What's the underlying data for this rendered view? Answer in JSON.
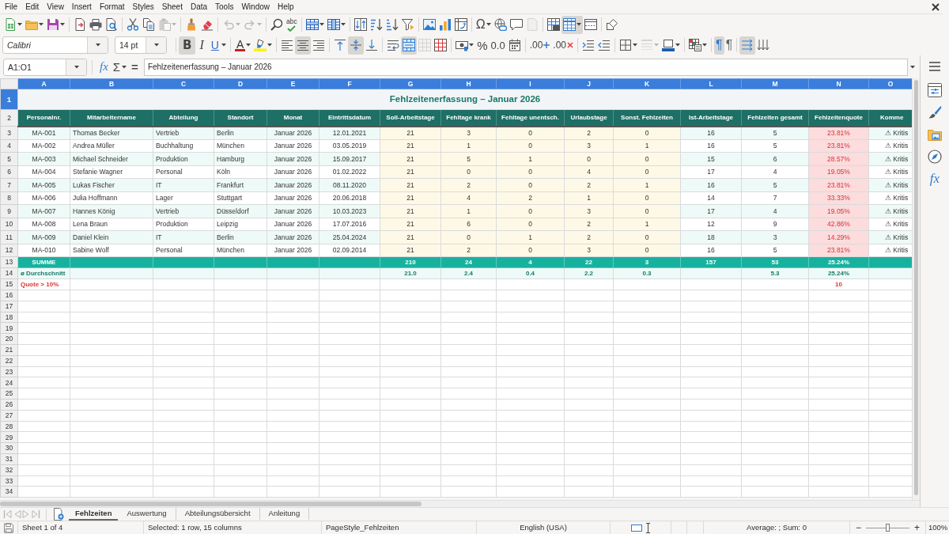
{
  "menu_bar": [
    "File",
    "Edit",
    "View",
    "Insert",
    "Format",
    "Styles",
    "Sheet",
    "Data",
    "Tools",
    "Window",
    "Help"
  ],
  "standard_toolbar": {
    "buttons": [
      {
        "on": false,
        "disabled": false
      },
      {
        "on": false,
        "disabled": false
      },
      {
        "on": false,
        "disabled": false
      },
      {
        "on": false,
        "disabled": false
      },
      {
        "on": false,
        "disabled": false
      },
      {
        "on": false,
        "disabled": false
      },
      {
        "on": false,
        "disabled": false
      },
      {
        "on": false,
        "disabled": false
      },
      {
        "on": false,
        "disabled": true
      },
      {
        "on": false,
        "disabled": false
      },
      {
        "on": false,
        "disabled": false
      },
      {
        "on": false,
        "disabled": true
      },
      {
        "on": false,
        "disabled": true
      },
      {
        "on": false,
        "disabled": false
      },
      {
        "glyph": "abc",
        "on": false,
        "disabled": false
      },
      {
        "on": false,
        "disabled": false
      },
      {
        "on": false,
        "disabled": false
      },
      {
        "on": false,
        "disabled": false
      },
      {
        "on": false,
        "disabled": false
      },
      {
        "on": false,
        "disabled": false
      },
      {
        "on": false,
        "disabled": false
      },
      {
        "on": false,
        "disabled": false
      },
      {
        "on": false,
        "disabled": false
      },
      {
        "on": false,
        "disabled": false
      },
      {
        "glyph": "Ω",
        "on": false,
        "disabled": false
      },
      {
        "on": false,
        "disabled": false
      },
      {
        "on": false,
        "disabled": false
      },
      {
        "on": false,
        "disabled": true
      },
      {
        "on": false,
        "disabled": false
      },
      {
        "on": true,
        "disabled": false
      },
      {
        "on": false,
        "disabled": false
      },
      {
        "on": false,
        "disabled": false
      }
    ]
  },
  "formatting_toolbar": {
    "font_name": "Calibri",
    "font_size": "14 pt",
    "buttons": [
      {
        "glyph": "B",
        "on": true,
        "disabled": false
      },
      {
        "glyph": "I",
        "on": false,
        "disabled": false
      },
      {
        "glyph": "U",
        "on": false,
        "disabled": false
      },
      {
        "glyph": "A",
        "on": false,
        "disabled": false
      },
      {
        "on": false,
        "disabled": false
      },
      {
        "on": false,
        "disabled": false
      },
      {
        "on": true,
        "disabled": false
      },
      {
        "on": false,
        "disabled": false
      },
      {
        "on": false,
        "disabled": false
      },
      {
        "on": true,
        "disabled": false
      },
      {
        "on": false,
        "disabled": false
      },
      {
        "on": false,
        "disabled": false
      },
      {
        "on": true,
        "disabled": false
      },
      {
        "on": false,
        "disabled": true
      },
      {
        "on": false,
        "disabled": false
      },
      {
        "on": false,
        "disabled": false
      },
      {
        "glyph": "%",
        "on": false,
        "disabled": false
      },
      {
        "glyph": "0.0",
        "on": false,
        "disabled": false
      },
      {
        "on": false,
        "disabled": false
      },
      {
        "glyph": ".00",
        "on": false,
        "disabled": false
      },
      {
        "glyph": ".00",
        "on": false,
        "disabled": false
      },
      {
        "on": false,
        "disabled": false
      },
      {
        "on": false,
        "disabled": false
      },
      {
        "on": false,
        "disabled": false
      },
      {
        "on": false,
        "disabled": true
      },
      {
        "on": false,
        "disabled": false
      },
      {
        "on": false,
        "disabled": false
      },
      {
        "glyph": "¶",
        "on": true,
        "disabled": false
      },
      {
        "glyph": "¶",
        "on": false,
        "disabled": false
      },
      {
        "on": true,
        "disabled": false
      },
      {
        "on": false,
        "disabled": false
      }
    ]
  },
  "formula_bar": {
    "name_box": "A1:O1",
    "function_wizard": "fx",
    "sum": "Σ",
    "equals": "=",
    "formula": "Fehlzeitenerfassung – Januar 2026"
  },
  "spreadsheet": {
    "columns": [
      {
        "label": "A",
        "selected": true
      },
      {
        "label": "B",
        "selected": true
      },
      {
        "label": "C",
        "selected": true
      },
      {
        "label": "D",
        "selected": true
      },
      {
        "label": "E",
        "selected": true
      },
      {
        "label": "F",
        "selected": true
      },
      {
        "label": "G",
        "selected": true
      },
      {
        "label": "H",
        "selected": true
      },
      {
        "label": "I",
        "selected": true
      },
      {
        "label": "J",
        "selected": true
      },
      {
        "label": "K",
        "selected": true
      },
      {
        "label": "L",
        "selected": true
      },
      {
        "label": "M",
        "selected": true
      },
      {
        "label": "N",
        "selected": true
      },
      {
        "label": "O",
        "selected": true
      }
    ],
    "row_headers": [
      {
        "label": "1",
        "selected": true
      },
      {
        "label": "2",
        "selected": false
      },
      {
        "label": "3",
        "selected": false
      },
      {
        "label": "4",
        "selected": false
      },
      {
        "label": "5",
        "selected": false
      },
      {
        "label": "6",
        "selected": false
      },
      {
        "label": "7",
        "selected": false
      },
      {
        "label": "8",
        "selected": false
      },
      {
        "label": "9",
        "selected": false
      },
      {
        "label": "10",
        "selected": false
      },
      {
        "label": "11",
        "selected": false
      },
      {
        "label": "12",
        "selected": false
      },
      {
        "label": "13",
        "selected": false
      },
      {
        "label": "14",
        "selected": false
      },
      {
        "label": "15",
        "selected": false
      },
      {
        "label": "16",
        "selected": false
      },
      {
        "label": "17",
        "selected": false
      },
      {
        "label": "18",
        "selected": false
      },
      {
        "label": "19",
        "selected": false
      },
      {
        "label": "20",
        "selected": false
      },
      {
        "label": "21",
        "selected": false
      },
      {
        "label": "22",
        "selected": false
      },
      {
        "label": "23",
        "selected": false
      },
      {
        "label": "24",
        "selected": false
      },
      {
        "label": "25",
        "selected": false
      },
      {
        "label": "26",
        "selected": false
      },
      {
        "label": "27",
        "selected": false
      },
      {
        "label": "28",
        "selected": false
      },
      {
        "label": "29",
        "selected": false
      },
      {
        "label": "30",
        "selected": false
      },
      {
        "label": "31",
        "selected": false
      },
      {
        "label": "32",
        "selected": false
      },
      {
        "label": "33",
        "selected": false
      },
      {
        "label": "34",
        "selected": false
      }
    ],
    "title": "Fehlzeitenerfassung – Januar 2026",
    "header": [
      "Personalnr.",
      "Mitarbeitername",
      "Abteilung",
      "Standort",
      "Monat",
      "Eintrittsdatum",
      "Soll-Arbeitstage",
      "Fehltage krank",
      "Fehltage unentsch.",
      "Urlaubstage",
      "Sonst. Fehlzeiten",
      "Ist-Arbeitstage",
      "Fehlzeiten gesamt",
      "Fehlzeitenquote",
      "Komme"
    ],
    "rows": [
      {
        "kind": "data",
        "cells": {
          "A": "MA-001",
          "B": "Thomas Becker",
          "C": "Vertrieb",
          "D": "Berlin",
          "E": "Januar 2026",
          "F": "12.01.2021",
          "G": "21",
          "H": "3",
          "I": "0",
          "J": "2",
          "K": "0",
          "L": "16",
          "M": "5",
          "N": "23.81%",
          "O": "⚠ Kritis"
        }
      },
      {
        "kind": "data",
        "cells": {
          "A": "MA-002",
          "B": "Andrea Müller",
          "C": "Buchhaltung",
          "D": "München",
          "E": "Januar 2026",
          "F": "03.05.2019",
          "G": "21",
          "H": "1",
          "I": "0",
          "J": "3",
          "K": "1",
          "L": "16",
          "M": "5",
          "N": "23.81%",
          "O": "⚠ Kritis"
        }
      },
      {
        "kind": "data",
        "cells": {
          "A": "MA-003",
          "B": "Michael Schneider",
          "C": "Produktion",
          "D": "Hamburg",
          "E": "Januar 2026",
          "F": "15.09.2017",
          "G": "21",
          "H": "5",
          "I": "1",
          "J": "0",
          "K": "0",
          "L": "15",
          "M": "6",
          "N": "28.57%",
          "O": "⚠ Kritis"
        }
      },
      {
        "kind": "data",
        "cells": {
          "A": "MA-004",
          "B": "Stefanie Wagner",
          "C": "Personal",
          "D": "Köln",
          "E": "Januar 2026",
          "F": "01.02.2022",
          "G": "21",
          "H": "0",
          "I": "0",
          "J": "4",
          "K": "0",
          "L": "17",
          "M": "4",
          "N": "19.05%",
          "O": "⚠ Kritis"
        }
      },
      {
        "kind": "data",
        "cells": {
          "A": "MA-005",
          "B": "Lukas Fischer",
          "C": "IT",
          "D": "Frankfurt",
          "E": "Januar 2026",
          "F": "08.11.2020",
          "G": "21",
          "H": "2",
          "I": "0",
          "J": "2",
          "K": "1",
          "L": "16",
          "M": "5",
          "N": "23.81%",
          "O": "⚠ Kritis"
        }
      },
      {
        "kind": "data",
        "cells": {
          "A": "MA-006",
          "B": "Julia Hoffmann",
          "C": "Lager",
          "D": "Stuttgart",
          "E": "Januar 2026",
          "F": "20.06.2018",
          "G": "21",
          "H": "4",
          "I": "2",
          "J": "1",
          "K": "0",
          "L": "14",
          "M": "7",
          "N": "33.33%",
          "O": "⚠ Kritis"
        }
      },
      {
        "kind": "data",
        "cells": {
          "A": "MA-007",
          "B": "Hannes König",
          "C": "Vertrieb",
          "D": "Düsseldorf",
          "E": "Januar 2026",
          "F": "10.03.2023",
          "G": "21",
          "H": "1",
          "I": "0",
          "J": "3",
          "K": "0",
          "L": "17",
          "M": "4",
          "N": "19.05%",
          "O": "⚠ Kritis"
        }
      },
      {
        "kind": "data",
        "cells": {
          "A": "MA-008",
          "B": "Lena Braun",
          "C": "Produktion",
          "D": "Leipzig",
          "E": "Januar 2026",
          "F": "17.07.2016",
          "G": "21",
          "H": "6",
          "I": "0",
          "J": "2",
          "K": "1",
          "L": "12",
          "M": "9",
          "N": "42.86%",
          "O": "⚠ Kritis"
        }
      },
      {
        "kind": "data",
        "cells": {
          "A": "MA-009",
          "B": "Daniel Klein",
          "C": "IT",
          "D": "Berlin",
          "E": "Januar 2026",
          "F": "25.04.2024",
          "G": "21",
          "H": "0",
          "I": "1",
          "J": "2",
          "K": "0",
          "L": "18",
          "M": "3",
          "N": "14.29%",
          "O": "⚠ Kritis"
        }
      },
      {
        "kind": "data",
        "cells": {
          "A": "MA-010",
          "B": "Sabine Wolf",
          "C": "Personal",
          "D": "München",
          "E": "Januar 2026",
          "F": "02.09.2014",
          "G": "21",
          "H": "2",
          "I": "0",
          "J": "3",
          "K": "0",
          "L": "16",
          "M": "5",
          "N": "23.81%",
          "O": "⚠ Kritis"
        }
      },
      {
        "kind": "total",
        "cells": {
          "A": "SUMME",
          "G": "210",
          "H": "24",
          "I": "4",
          "J": "22",
          "K": "3",
          "L": "157",
          "M": "53",
          "N": "25.24%"
        }
      },
      {
        "kind": "average",
        "cells": {
          "A": "ø Durchschnitt",
          "G": "21.0",
          "H": "2.4",
          "I": "0.4",
          "J": "2.2",
          "K": "0.3",
          "M": "5.3",
          "N": "25.24%"
        }
      },
      {
        "kind": "threshold",
        "cells": {
          "A": "Quote > 10%",
          "N": "10"
        }
      }
    ]
  },
  "sheet_tabs": [
    {
      "label": "Fehlzeiten",
      "selected": true
    },
    {
      "label": "Auswertung",
      "selected": false
    },
    {
      "label": "Abteilungsübersicht",
      "selected": false
    },
    {
      "label": "Anleitung",
      "selected": false
    }
  ],
  "sidebar": {
    "functions_tab": "fx"
  },
  "status_bar": {
    "sheet": "Sheet 1 of 4",
    "selection": "Selected: 1 row, 15 columns",
    "page_style": "PageStyle_Fehlzeiten",
    "language": "English (USA)",
    "summary": "Average: ; Sum: 0",
    "zoom_out": "−",
    "zoom": {
      "level": 0.5
    },
    "zoom_in": "+",
    "zoom_percent": "100%"
  }
}
